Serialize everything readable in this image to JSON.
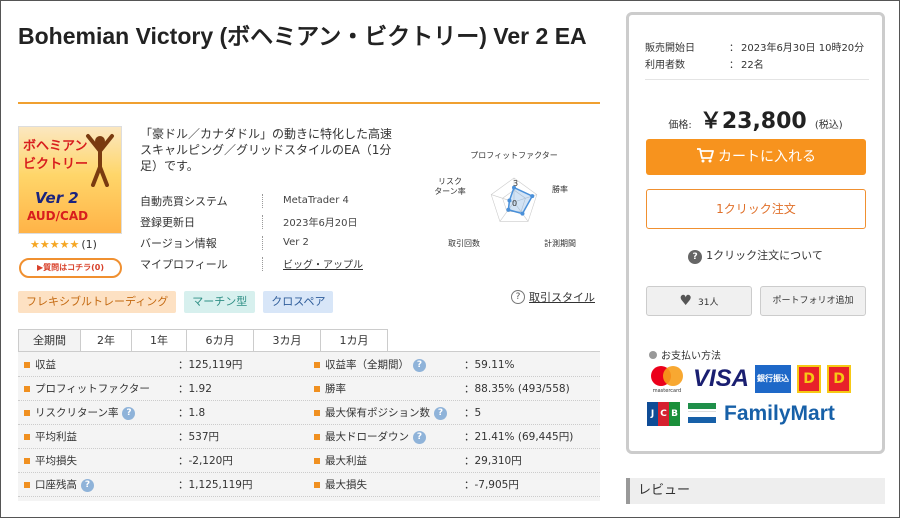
{
  "product": {
    "title": "Bohemian Victory (ボヘミアン・ビクトリー) Ver 2 EA",
    "thumbnail": {
      "line1": "ボヘミアン",
      "line2": "ビクトリー",
      "line3": "Ver 2",
      "line4": "AUD/CAD"
    },
    "rating": {
      "stars": "★★★★★",
      "count": "(1)"
    },
    "ask_button": "▶質問はコチラ(0)",
    "description": "「豪ドル／カナダドル」の動きに特化した高速スキャルピング／グリッドスタイルのEA（1分足）です。",
    "specs": [
      {
        "key": "自動売買システム",
        "value": "MetaTrader 4"
      },
      {
        "key": "登録更新日",
        "value": "2023年6月20日"
      },
      {
        "key": "バージョン情報",
        "value": "Ver 2"
      },
      {
        "key": "マイプロフィール",
        "value": "ビッグ・アップル"
      }
    ],
    "radar": {
      "labels": [
        "プロフィットファクター",
        "勝率",
        "計測期間",
        "取引回数",
        "リスク\nターン率"
      ],
      "values": [
        3,
        4,
        3,
        2,
        1
      ],
      "max": 5,
      "center_label": "0",
      "scale_label": "3",
      "color": "#4a90d9"
    },
    "tags": [
      "フレキシブルトレーディング",
      "マーチン型",
      "クロスペア"
    ],
    "trade_style_link": "取引スタイル"
  },
  "period_tabs": [
    "全期間",
    "2年",
    "1年",
    "6カ月",
    "3カ月",
    "1カ月"
  ],
  "stats_left": [
    {
      "label": "収益",
      "value": "：125,119円",
      "info": false
    },
    {
      "label": "プロフィットファクター",
      "value": "：1.92",
      "info": false
    },
    {
      "label": "リスクリターン率",
      "value": "：1.8",
      "info": true
    },
    {
      "label": "平均利益",
      "value": "：537円",
      "info": false
    },
    {
      "label": "平均損失",
      "value": "：-2,120円",
      "info": false
    },
    {
      "label": "口座残高",
      "value": "：1,125,119円",
      "info": true
    }
  ],
  "stats_right": [
    {
      "label": "収益率（全期間）",
      "value": "：59.11%",
      "info": true
    },
    {
      "label": "勝率",
      "value": "：88.35% (493/558)",
      "info": false
    },
    {
      "label": "最大保有ポジション数",
      "value": "：5",
      "info": true
    },
    {
      "label": "最大ドローダウン",
      "value": "：21.41% (69,445円)",
      "info": true
    },
    {
      "label": "最大利益",
      "value": "：29,310円",
      "info": false
    },
    {
      "label": "最大損失",
      "value": "：-7,905円",
      "info": false
    }
  ],
  "buybox": {
    "release_label": "販売開始日",
    "release_value": "2023年6月30日 10時20分",
    "users_label": "利用者数",
    "users_value": "22名",
    "colon": "：",
    "price_label": "価格:",
    "price": "￥23,800",
    "tax": "(税込)",
    "cart_button": "カートに入れる",
    "oneclick_button": "1クリック注文",
    "about_oneclick": "1クリック注文について",
    "favorite_count": "31人",
    "portfolio_button": "ポートフォリオ追加",
    "payment_title": "お支払い方法",
    "payment_logos": {
      "mastercard": "mastercard",
      "visa": "VISA",
      "bank": "銀行振込",
      "daily": "D",
      "jcb": [
        "J",
        "C",
        "B"
      ],
      "familymart": "FamilyMart"
    }
  },
  "review_heading": "レビュー",
  "colors": {
    "accent": "#f7931e",
    "rule": "#f0a030",
    "info": "#8fb3d9"
  }
}
